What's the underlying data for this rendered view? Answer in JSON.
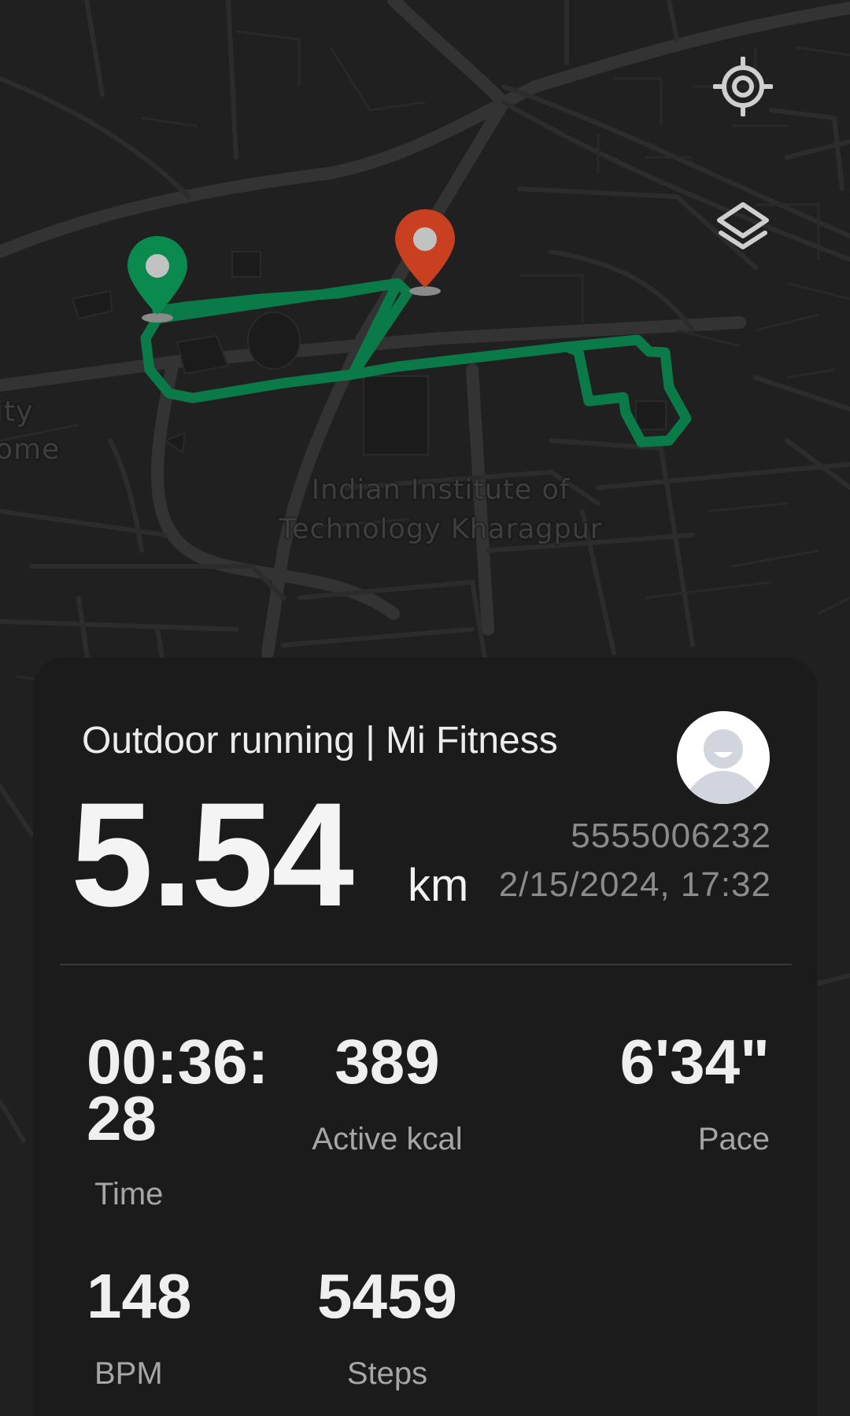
{
  "map": {
    "place_label_line1": "Indian Institute of",
    "place_label_line2": "Technology Kharagpur",
    "edge_label_line1": "ity",
    "edge_label_line2": "ome",
    "route_color": "#0a7a48",
    "start_marker_color": "#0a8a4f",
    "end_marker_color": "#c8401f",
    "locate_icon": "crosshair-icon",
    "layers_icon": "layers-icon"
  },
  "workout": {
    "title": "Outdoor running | Mi Fitness",
    "distance": "5.54",
    "distance_unit": "km",
    "user_id": "5555006232",
    "datetime": "2/15/2024, 17:32"
  },
  "stats": {
    "time": {
      "value_line1": "00:36:",
      "value_line2": "28",
      "label": "Time"
    },
    "kcal": {
      "value": "389",
      "label": "Active kcal"
    },
    "pace": {
      "value": "6'34\"",
      "label": "Pace"
    },
    "bpm": {
      "value": "148",
      "label": "BPM"
    },
    "steps": {
      "value": "5459",
      "label": "Steps"
    }
  }
}
